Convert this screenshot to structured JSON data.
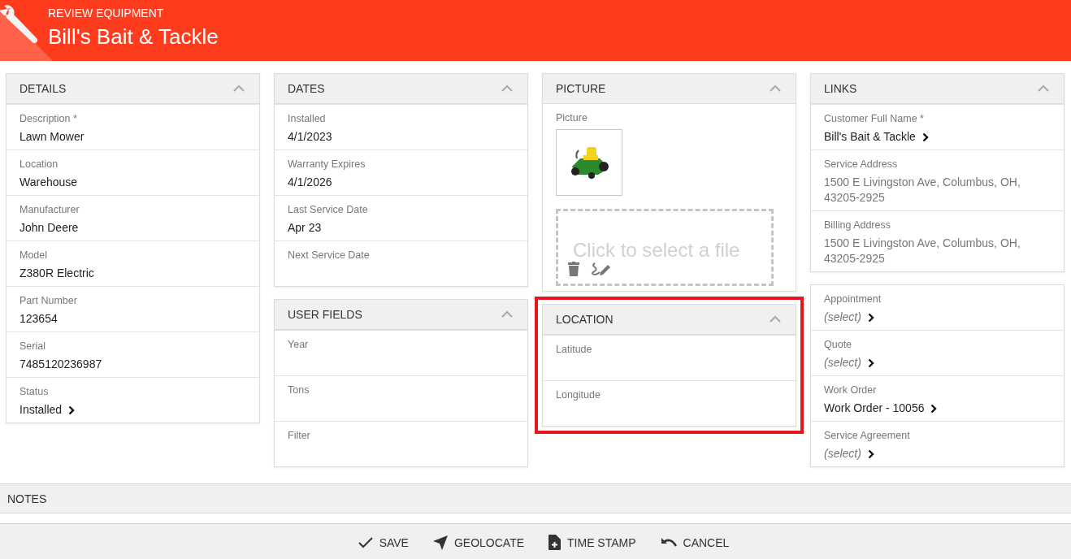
{
  "header": {
    "subtitle": "REVIEW EQUIPMENT",
    "title": "Bill's Bait & Tackle"
  },
  "columns": [
    [
      {
        "kind": "fields",
        "title": "DETAILS",
        "expanded": true,
        "highlighted": false,
        "fields": [
          {
            "label": "Description *",
            "value": "Lawn Mower",
            "kind": "text"
          },
          {
            "label": "Location",
            "value": "Warehouse",
            "kind": "text"
          },
          {
            "label": "Manufacturer",
            "value": "John Deere",
            "kind": "text"
          },
          {
            "label": "Model",
            "value": "Z380R Electric",
            "kind": "text"
          },
          {
            "label": "Part Number",
            "value": "123654",
            "kind": "text"
          },
          {
            "label": "Serial",
            "value": "7485120236987",
            "kind": "text"
          },
          {
            "label": "Status",
            "value": "Installed",
            "kind": "link"
          }
        ]
      }
    ],
    [
      {
        "kind": "fields",
        "title": "DATES",
        "expanded": true,
        "highlighted": false,
        "fields": [
          {
            "label": "Installed",
            "value": "4/1/2023",
            "kind": "text"
          },
          {
            "label": "Warranty Expires",
            "value": "4/1/2026",
            "kind": "text"
          },
          {
            "label": "Last Service Date",
            "value": "Apr 23",
            "kind": "text"
          },
          {
            "label": "Next Service Date"
          }
        ]
      },
      {
        "kind": "fields",
        "title": "USER FIELDS",
        "expanded": true,
        "highlighted": false,
        "fields": [
          {
            "label": "Year"
          },
          {
            "label": "Tons"
          },
          {
            "label": "Filter"
          }
        ]
      }
    ],
    [
      {
        "kind": "picture",
        "title": "PICTURE",
        "expanded": true,
        "highlighted": false,
        "label": "Picture",
        "dropzone_placeholder": "Click to select a file"
      },
      {
        "kind": "fields",
        "title": "LOCATION",
        "expanded": true,
        "highlighted": true,
        "fields": [
          {
            "label": "Latitude"
          },
          {
            "label": "Longitude"
          }
        ]
      }
    ],
    [
      {
        "kind": "fields",
        "title": "LINKS",
        "expanded": true,
        "highlighted": false,
        "fields": [
          {
            "label": "Customer Full Name *",
            "value": "Bill's Bait & Tackle",
            "kind": "link"
          },
          {
            "label": "Service Address",
            "value": "1500 E Livingston Ave, Columbus, OH, 43205-2925",
            "kind": "address"
          },
          {
            "label": "Billing Address",
            "value": "1500 E Livingston Ave, Columbus, OH, 43205-2925",
            "kind": "address"
          }
        ]
      },
      {
        "kind": "fields",
        "highlighted": false,
        "fields": [
          {
            "label": "Appointment",
            "placeholder": "(select)",
            "kind": "select"
          },
          {
            "label": "Quote",
            "placeholder": "(select)",
            "kind": "select"
          },
          {
            "label": "Work Order",
            "value": "Work Order - 10056",
            "kind": "link"
          },
          {
            "label": "Service Agreement",
            "placeholder": "(select)",
            "kind": "select"
          }
        ]
      }
    ]
  ],
  "notes": {
    "title": "NOTES"
  },
  "actions": [
    {
      "label": "SAVE",
      "kind": "save"
    },
    {
      "label": "GEOLOCATE",
      "kind": "geolocate"
    },
    {
      "label": "TIME STAMP",
      "kind": "timestamp"
    },
    {
      "label": "CANCEL",
      "kind": "cancel"
    }
  ]
}
